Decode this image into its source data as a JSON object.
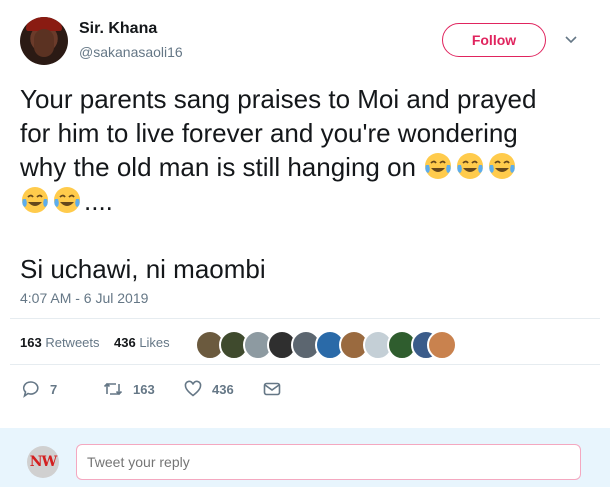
{
  "author": {
    "name": "Sir. Khana",
    "handle": "@sakanasaoli16"
  },
  "follow_label": "Follow",
  "tweet": {
    "line1": "Your parents sang praises to Moi and prayed",
    "line2": "for him to live forever and you're wondering",
    "line3": "why the old man is still hanging on ",
    "line4_suffix": "....",
    "line5": "Si uchawi, ni maombi",
    "emoji": "face-with-tears-of-joy-icon"
  },
  "timestamp": "4:07 AM - 6 Jul 2019",
  "stats": {
    "retweets_count": "163",
    "retweets_label": "Retweets",
    "likes_count": "436",
    "likes_label": "Likes"
  },
  "actions": {
    "replies": "7",
    "retweets": "163",
    "likes": "436"
  },
  "reply": {
    "avatar_text": "NW",
    "placeholder": "Tweet your reply"
  },
  "colors": {
    "accent": "#e0245e",
    "link_blue": "#1da1f2",
    "muted": "#657786",
    "reply_bar": "#e8f5fd"
  }
}
